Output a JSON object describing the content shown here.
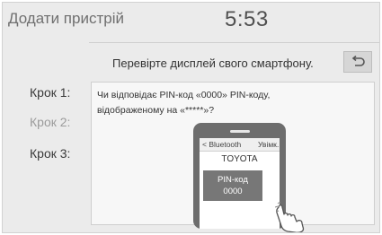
{
  "header": {
    "title": "Додати пристрій",
    "clock": "5:53"
  },
  "instruction": "Перевірте дисплей свого смартфону.",
  "back_icon": "return-arrow-icon",
  "steps": [
    {
      "label": "Крок 1:"
    },
    {
      "label": "Крок 2:"
    },
    {
      "label": "Крок 3:"
    }
  ],
  "panel": {
    "line1": "Чи відповідає PIN-код «0000» PIN-коду,",
    "line2": "відображеному на «*****»?"
  },
  "phone": {
    "bt_back": "< Bluetooth",
    "bt_toggle": "Увімк.",
    "device": "TOYOTA",
    "pin_label": "PIN-код",
    "pin_value": "0000"
  },
  "colors": {
    "screen_bg": "#ebebeb",
    "panel_bg": "#f7f7f7",
    "phone_body": "#6d6d6d",
    "pin_box": "#777777"
  }
}
